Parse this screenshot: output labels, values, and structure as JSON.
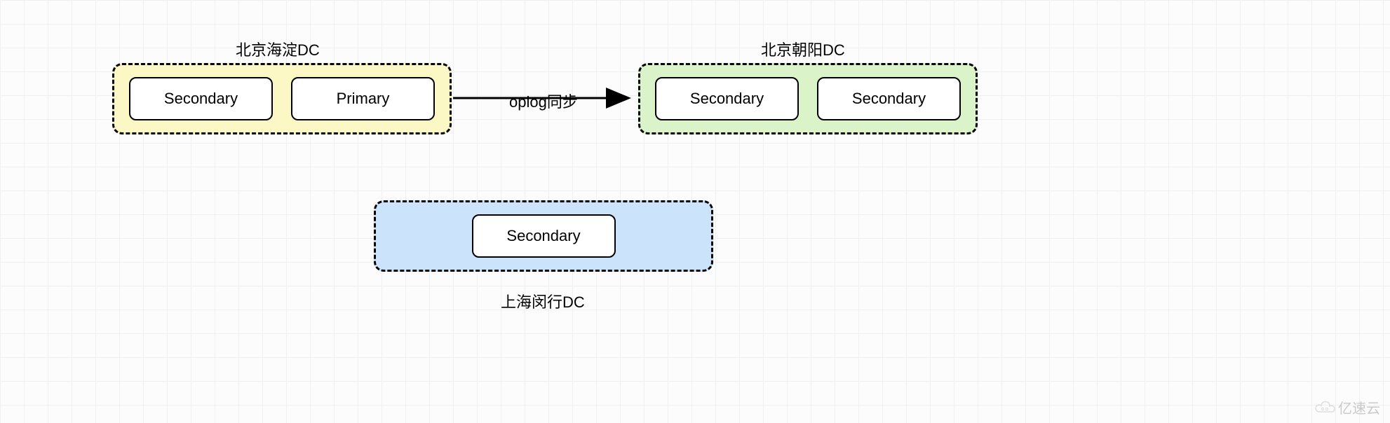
{
  "dc1": {
    "title": "北京海淀DC",
    "nodes": [
      "Secondary",
      "Primary"
    ]
  },
  "dc2": {
    "title": "北京朝阳DC",
    "nodes": [
      "Secondary",
      "Secondary"
    ]
  },
  "dc3": {
    "title": "上海闵行DC",
    "nodes": [
      "Secondary"
    ]
  },
  "arrow_label": "oplog同步",
  "watermark": "亿速云"
}
